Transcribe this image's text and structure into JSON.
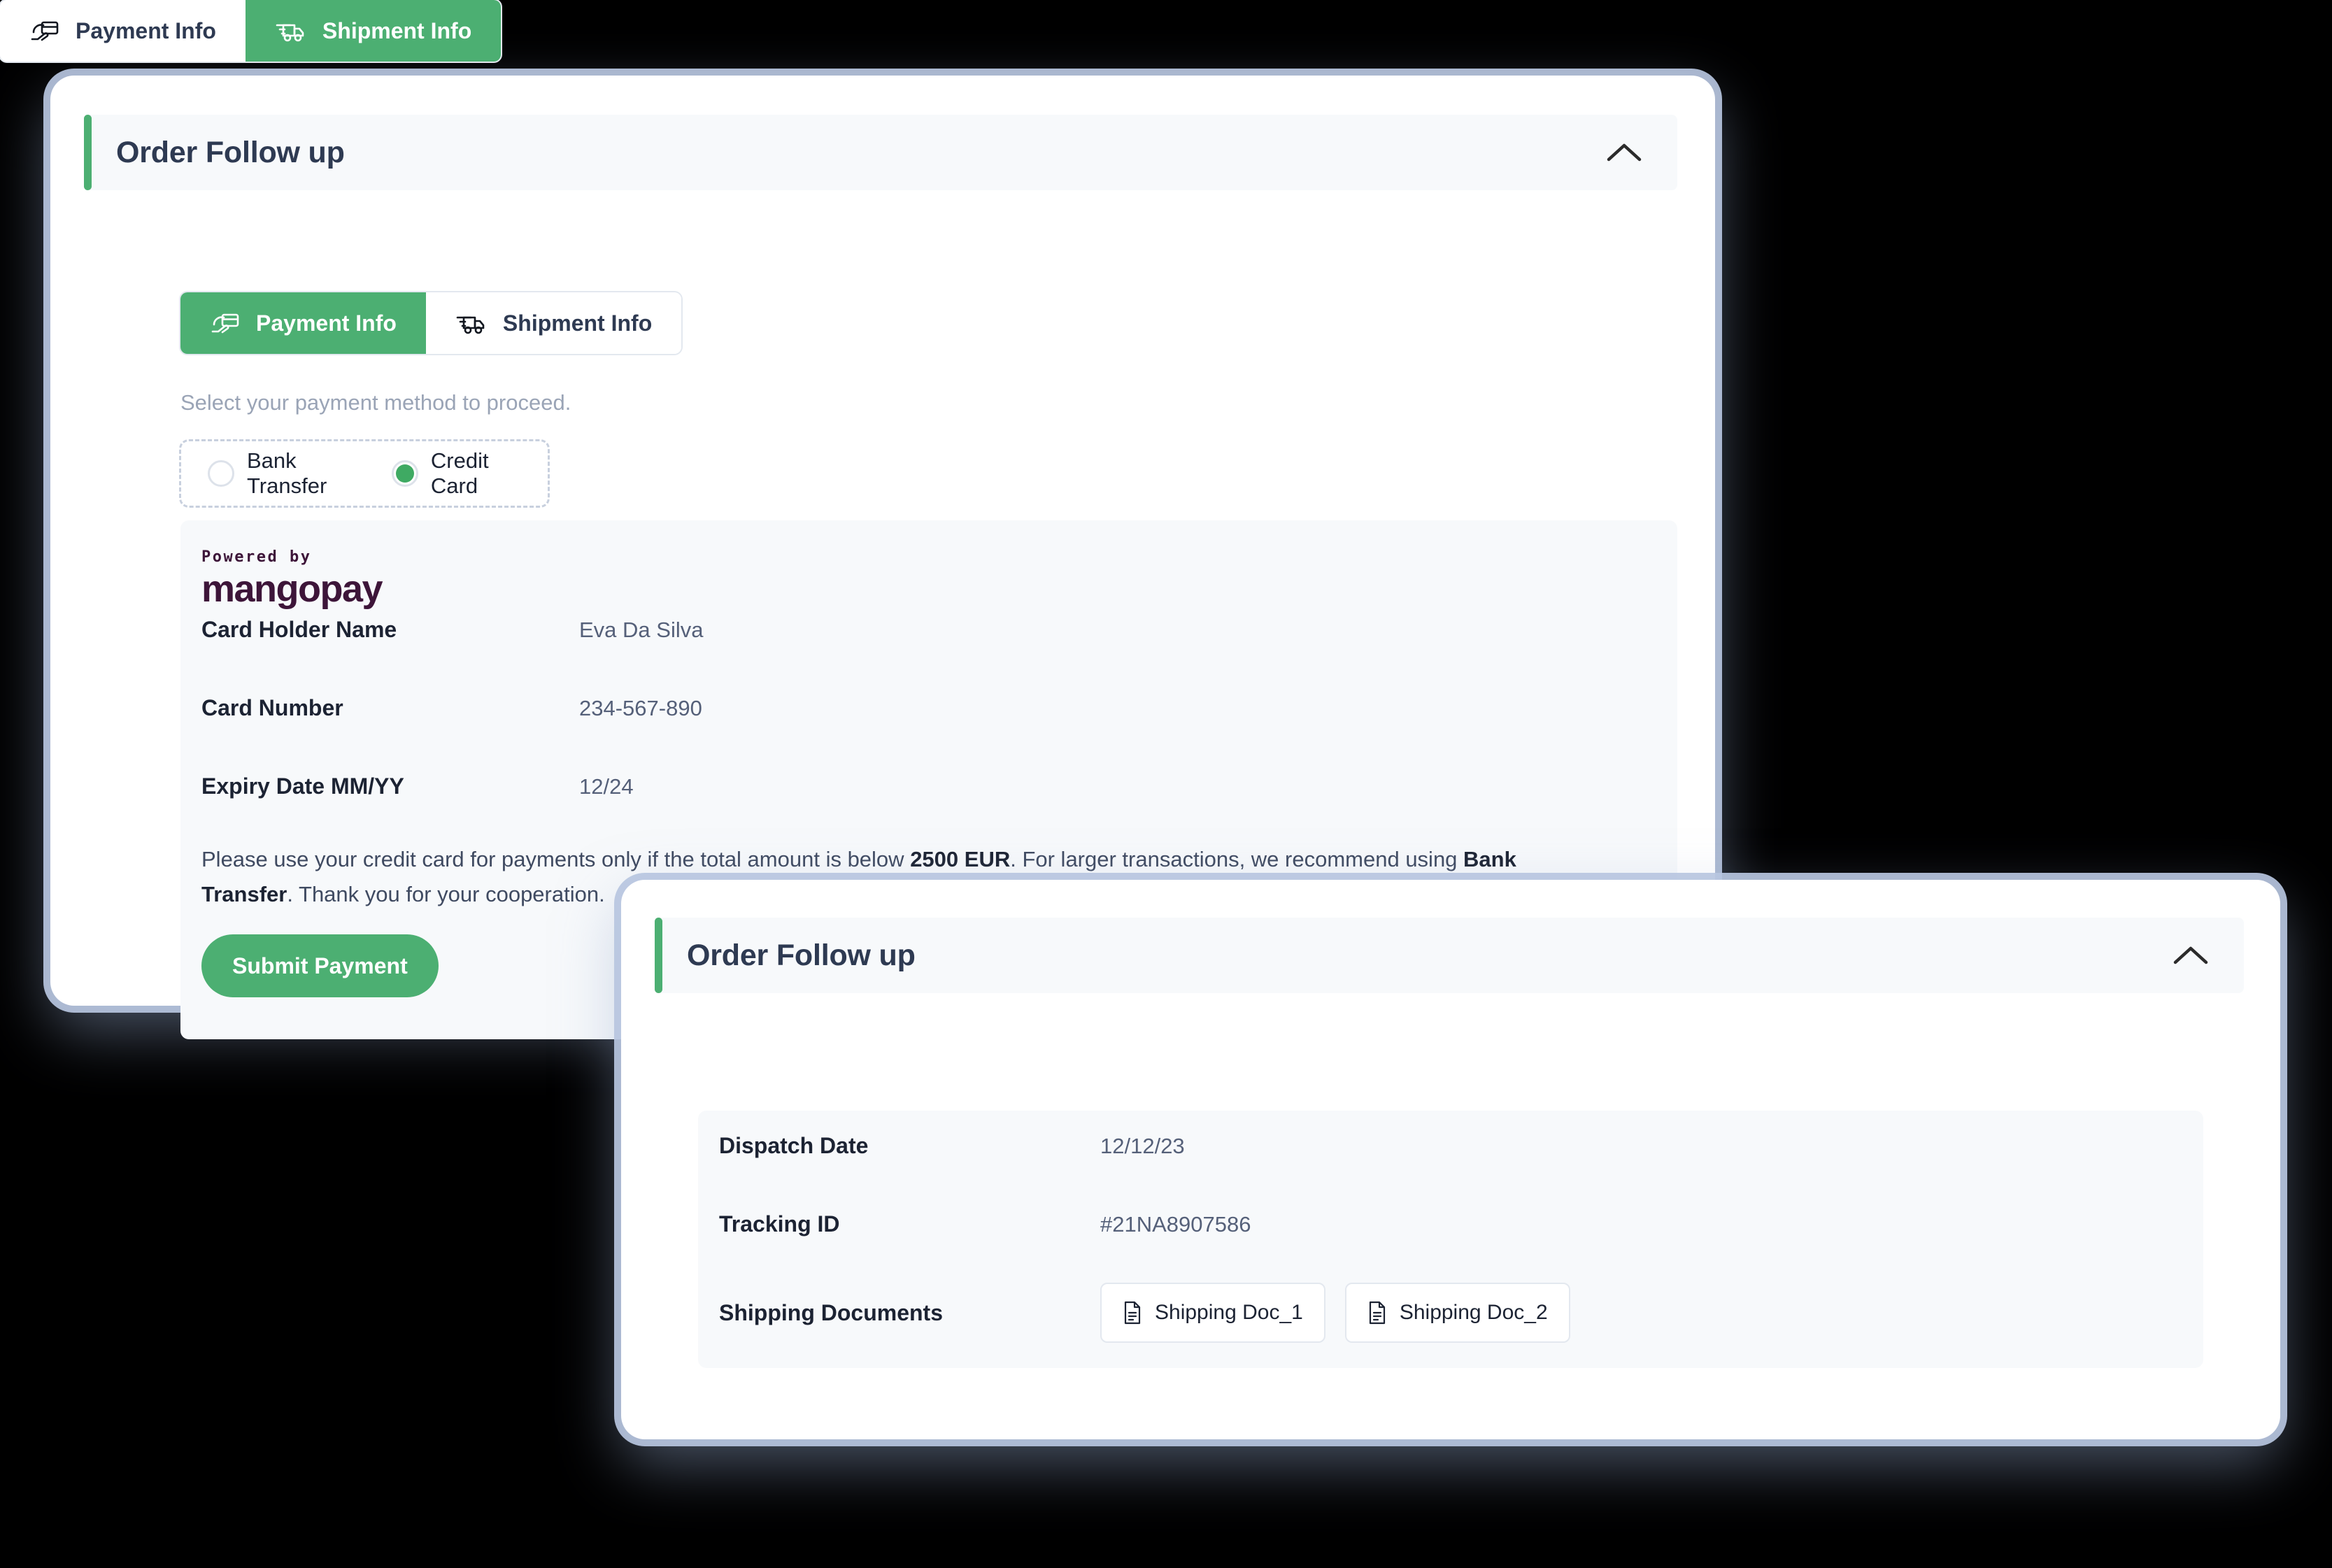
{
  "theme": {
    "accent_green": "#4caf72",
    "title_navy": "#2e3a52",
    "panel_bg": "#f7f9fb",
    "brand_purple": "#3d1539",
    "page_background": "#000000"
  },
  "payment_card": {
    "title": "Order Follow up",
    "collapse_icon": "chevron-up-icon",
    "tabs": [
      {
        "label": "Payment Info",
        "icon": "card-in-hand-icon",
        "active": true
      },
      {
        "label": "Shipment Info",
        "icon": "delivery-truck-icon",
        "active": false
      }
    ],
    "helper_text": "Select your payment method to proceed.",
    "payment_methods": [
      {
        "label": "Bank Transfer",
        "selected": false
      },
      {
        "label": "Credit Card",
        "selected": true
      }
    ],
    "brand": {
      "powered_by": "Powered by",
      "name": "mangopay"
    },
    "fields": [
      {
        "label": "Card Holder Name",
        "value": "Eva Da Silva"
      },
      {
        "label": "Card Number",
        "value": "234-567-890"
      },
      {
        "label": "Expiry Date MM/YY",
        "value": "12/24"
      }
    ],
    "disclaimer": {
      "part1": "Please use your credit card for payments only if the total amount is below ",
      "bold1": "2500 EUR",
      "part2": ". For larger transactions, we recommend using ",
      "bold2": "Bank Transfer",
      "part3": ". Thank you for your cooperation."
    },
    "submit_label": "Submit Payment"
  },
  "shipment_card": {
    "title": "Order Follow up",
    "collapse_icon": "chevron-up-icon",
    "tabs": [
      {
        "label": "Payment Info",
        "icon": "card-in-hand-icon",
        "active": false
      },
      {
        "label": "Shipment Info",
        "icon": "delivery-truck-icon",
        "active": true
      }
    ],
    "fields": [
      {
        "label": "Dispatch Date",
        "value": "12/12/23"
      },
      {
        "label": "Tracking ID",
        "value": "#21NA8907586"
      },
      {
        "label": "Shipping Documents",
        "value": ""
      }
    ],
    "documents": [
      {
        "label": "Shipping Doc_1",
        "icon": "document-icon"
      },
      {
        "label": "Shipping Doc_2",
        "icon": "document-icon"
      }
    ]
  }
}
